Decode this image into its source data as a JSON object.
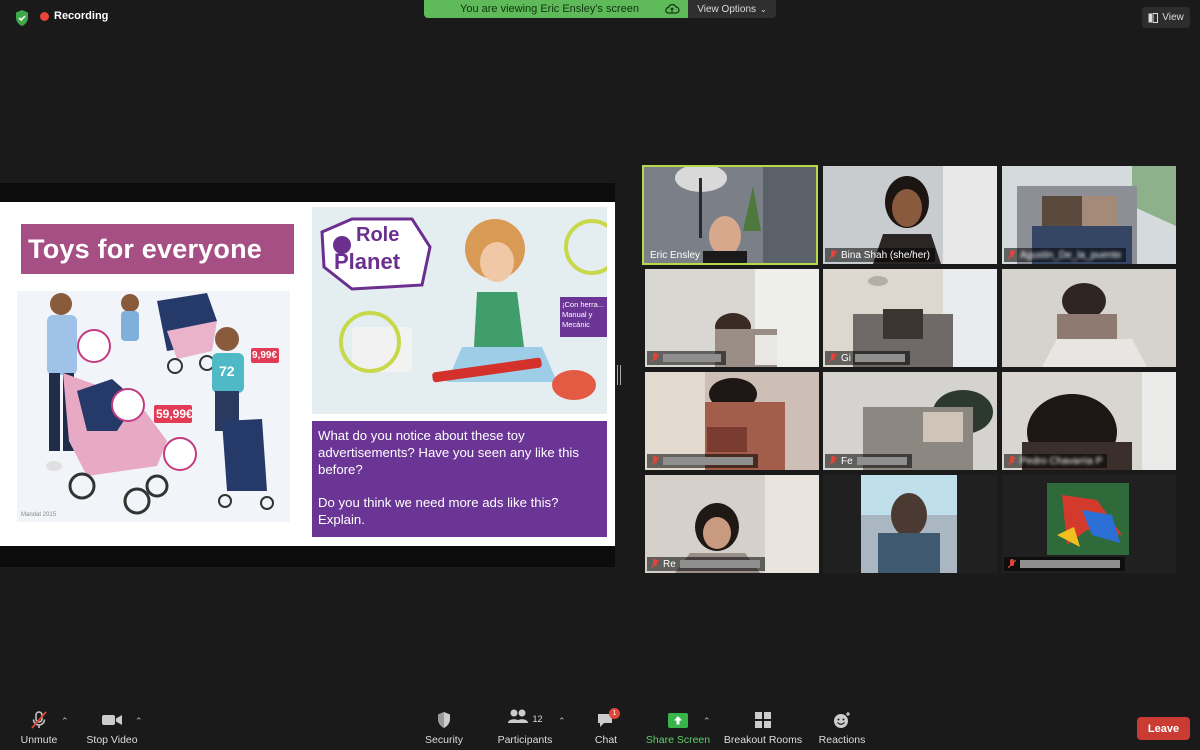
{
  "status": {
    "recording_label": "Recording",
    "banner_text": "You are viewing Eric Ensley's screen",
    "view_options_label": "View Options",
    "view_label": "View"
  },
  "slide": {
    "title": "Toys for everyone",
    "ad_right_brand_line1": "Role",
    "ad_right_brand_line2": "Planet",
    "ad_right_side_text": "¡Con herra... Manual y Mecánic",
    "ad_left_price_1": "9,99€",
    "ad_left_price_2": "59,99€",
    "ad_left_shirt_number": "72",
    "ad_left_footer": "Mandat 2015",
    "question_1": "What do you notice about these toy advertisements? Have you seen any like this before?",
    "question_2": "Do you think we need more ads like this? Explain."
  },
  "participants": [
    {
      "name": "Eric Ensley",
      "active": true
    },
    {
      "name": "Bina Shah (she/her)",
      "active": false
    },
    {
      "name": "Agustin_De_la_puente",
      "active": false
    },
    {
      "name": "",
      "active": false
    },
    {
      "name": "Gi",
      "active": false
    },
    {
      "name": "",
      "active": false
    },
    {
      "name": "",
      "active": false
    },
    {
      "name": "Fe",
      "active": false
    },
    {
      "name": "Pedro Chavarria P",
      "active": false
    },
    {
      "name": "Re",
      "active": false
    },
    {
      "name": "",
      "active": false
    },
    {
      "name": "",
      "active": false
    }
  ],
  "toolbar": {
    "unmute": "Unmute",
    "stop_video": "Stop Video",
    "security": "Security",
    "participants": "Participants",
    "participants_count": "12",
    "chat": "Chat",
    "chat_badge": "1",
    "share_screen": "Share Screen",
    "breakout_rooms": "Breakout Rooms",
    "reactions": "Reactions",
    "leave": "Leave"
  },
  "colors": {
    "share_green": "#5fbb5a",
    "active_speaker": "#b6d94c",
    "leave_red": "#c93b33",
    "slide_title_bg": "#a64f84",
    "question_bg": "#6b3596"
  }
}
